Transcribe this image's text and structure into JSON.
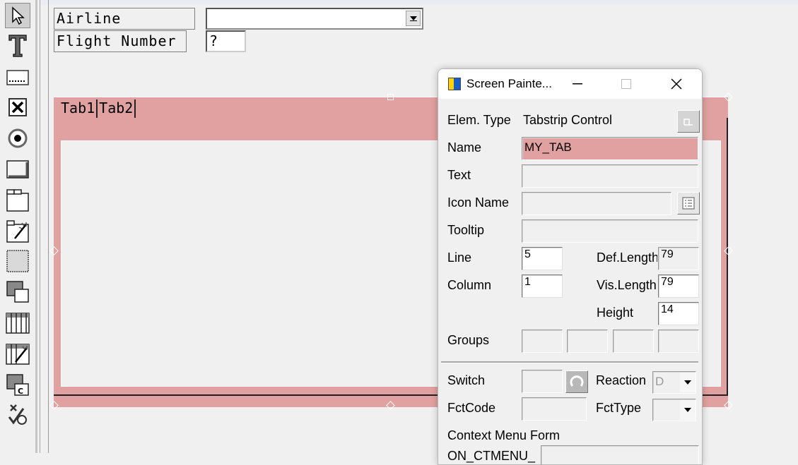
{
  "toolbar": {
    "tools": [
      "select-arrow",
      "text-field",
      "entry-field",
      "checkbox",
      "radio-button",
      "pushbutton",
      "tabstrip",
      "tabstrip-wizard",
      "box",
      "subscreen",
      "table-control",
      "table-control-wizard",
      "custom-control",
      "status-icon"
    ]
  },
  "screen": {
    "airline_label": "Airline",
    "airline_value": "",
    "flight_number_label": "Flight Number",
    "flight_number_value": "?",
    "tabs": [
      "Tab1",
      "Tab2"
    ],
    "tabstrip_color": "#e2a1a1"
  },
  "dialog": {
    "title": "Screen Painte...",
    "elem_type_label": "Elem. Type",
    "elem_type_value": "Tabstrip Control",
    "name_label": "Name",
    "name_value": "MY_TAB",
    "text_label": "Text",
    "text_value": "",
    "icon_name_label": "Icon Name",
    "icon_name_value": "",
    "tooltip_label": "Tooltip",
    "tooltip_value": "",
    "line_label": "Line",
    "line_value": "5",
    "column_label": "Column",
    "column_value": "1",
    "def_length_label": "Def.Length",
    "def_length_value": "79",
    "vis_length_label": "Vis.Length",
    "vis_length_value": "79",
    "height_label": "Height",
    "height_value": "14",
    "groups_label": "Groups",
    "switch_label": "Switch",
    "reaction_label": "Reaction",
    "reaction_value": "D",
    "fctcode_label": "FctCode",
    "fcttype_label": "FctType",
    "context_menu_label": "Context Menu Form",
    "on_ctmenu_label": "ON_CTMENU_"
  }
}
